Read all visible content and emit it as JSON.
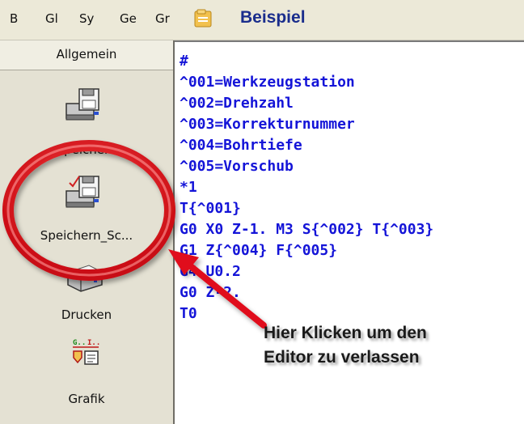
{
  "toolbar": {
    "menu_items": [
      "B",
      "Gl",
      "Sy",
      "Ge",
      "Gr"
    ],
    "folder_icon": "folder-icon",
    "title": "Beispiel"
  },
  "sidebar": {
    "header": "Allgemein",
    "items": [
      {
        "label": "Speichern",
        "icon": "save-disk-icon"
      },
      {
        "label": "Speichern_Sc...",
        "icon": "save-disk-check-icon"
      },
      {
        "label": "Drucken",
        "icon": "printer-icon"
      },
      {
        "label": "Grafik",
        "icon": "graphic-icon"
      }
    ]
  },
  "editor": {
    "lines": [
      "#",
      "^001=Werkzeugstation",
      "^002=Drehzahl",
      "^003=Korrekturnummer",
      "^004=Bohrtiefe",
      "^005=Vorschub",
      "*1",
      "T{^001}",
      "G0 X0 Z-1. M3 S{^002} T{^003}",
      "G1 Z{^004} F{^005}",
      "G4 U0.2",
      "G0 Z-2.",
      "T0"
    ]
  },
  "annotation": {
    "lines": [
      "Hier Klicken um den",
      "Editor zu verlassen"
    ],
    "ring_color": "#e0101a",
    "arrow_color": "#e0101a"
  },
  "colors": {
    "code_text": "#1414d8",
    "title_text": "#1a2d8c",
    "panel_bg": "#e4e1d3"
  }
}
